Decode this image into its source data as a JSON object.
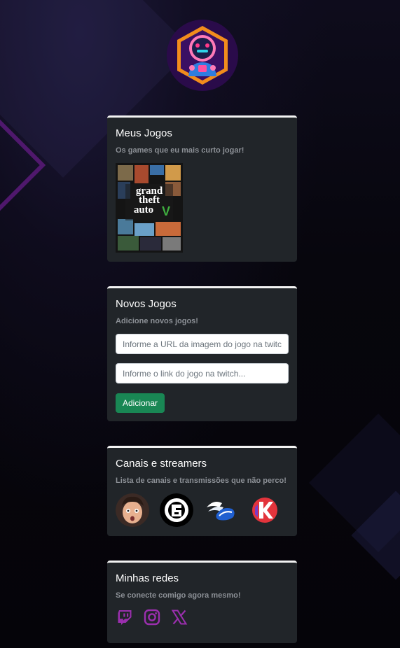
{
  "profile": {
    "avatar_icon": "astronaut-logo-icon"
  },
  "games_card": {
    "title": "Meus Jogos",
    "subtitle": "Os games que eu mais curto jogar!",
    "games": [
      {
        "cover_icon": "gta-v-cover",
        "cover_text": [
          "grand",
          "theft",
          "auto",
          "V"
        ]
      }
    ]
  },
  "new_games_card": {
    "title": "Novos Jogos",
    "subtitle": "Adicione novos jogos!",
    "image_url_input": {
      "value": "",
      "placeholder": "Informe a URL da imagem do jogo na twitch"
    },
    "game_link_input": {
      "value": "",
      "placeholder": "Informe o link do jogo na twitch..."
    },
    "add_button_label": "Adicionar"
  },
  "channels_card": {
    "title": "Canais e streamers",
    "subtitle": "Lista de canais e transmissões que não perco!",
    "channels": [
      {
        "icon": "streamer-face-avatar"
      },
      {
        "icon": "rainbow-six-siege-logo"
      },
      {
        "icon": "winged-helmet-logo"
      },
      {
        "icon": "red-k-logo"
      }
    ]
  },
  "social_card": {
    "title": "Minhas redes",
    "subtitle": "Se conecte comigo agora mesmo!",
    "links": [
      {
        "icon": "twitch-icon"
      },
      {
        "icon": "instagram-icon"
      },
      {
        "icon": "x-icon"
      }
    ]
  },
  "colors": {
    "background": "#07060d",
    "card": "#212529",
    "card_border": "#f3f3f3",
    "accent_purple": "#9b2fae",
    "button_green": "#198754"
  }
}
